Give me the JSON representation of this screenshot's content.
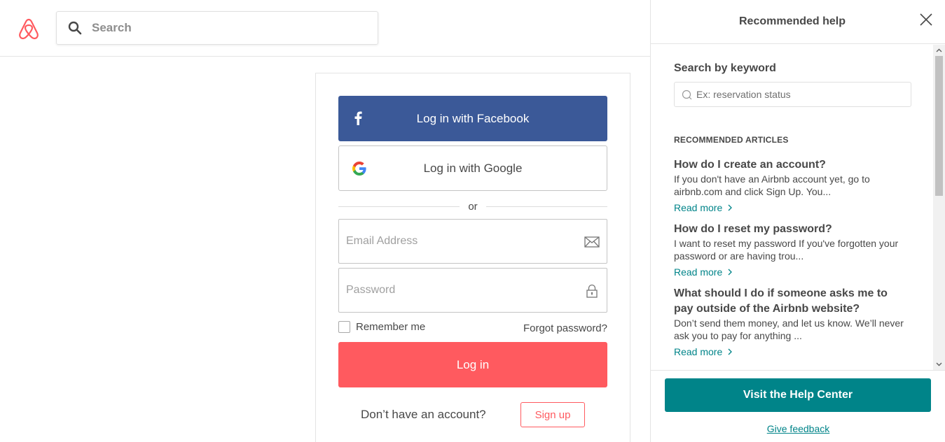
{
  "header": {
    "logo_icon": "airbnb-logo",
    "search_placeholder": "Search",
    "search_icon": "search-icon"
  },
  "login": {
    "facebook_label": "Log in with Facebook",
    "google_label": "Log in with Google",
    "divider_text": "or",
    "email_placeholder": "Email Address",
    "password_placeholder": "Password",
    "remember_label": "Remember me",
    "remember_checked": false,
    "forgot_label": "Forgot password?",
    "login_label": "Log in",
    "no_account_text": "Don’t have an account?",
    "signup_label": "Sign up"
  },
  "help": {
    "title": "Recommended help",
    "keyword_title": "Search by keyword",
    "keyword_placeholder": "Ex: reservation status",
    "recommended_title": "RECOMMENDED ARTICLES",
    "articles": [
      {
        "title": "How do I create an account?",
        "desc": "If you don't have an Airbnb account yet, go to airbnb.com and click Sign Up. You...",
        "more": "Read more"
      },
      {
        "title": "How do I reset my password?",
        "desc": "I want to reset my password If you've forgotten your password or are having trou...",
        "more": "Read more"
      },
      {
        "title": "What should I do if someone asks me to pay outside of the Airbnb website?",
        "desc": "Don’t send them money, and let us know. We’ll never ask you to pay for anything ...",
        "more": "Read more"
      }
    ],
    "visit_label": "Visit the Help Center",
    "feedback_label": "Give feedback"
  },
  "colors": {
    "brand": "#ff5a5f",
    "facebook": "#3b5998",
    "teal": "#008489"
  }
}
